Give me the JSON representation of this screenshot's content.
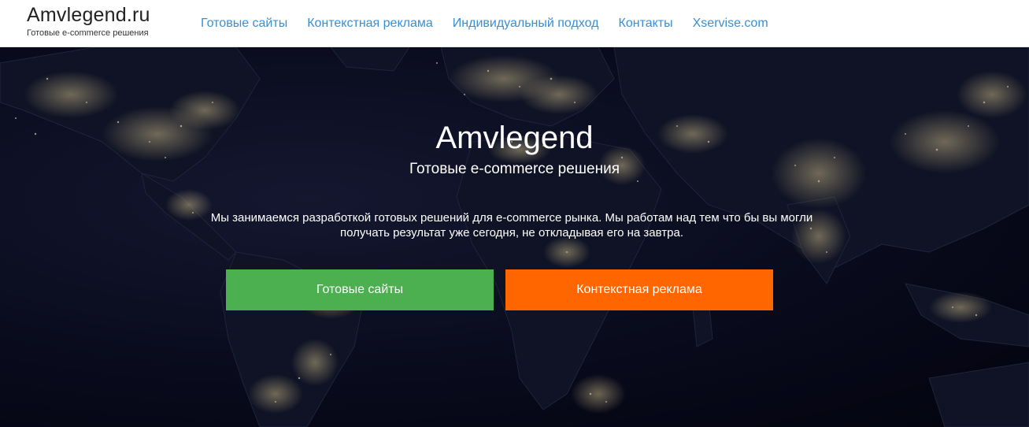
{
  "brand": {
    "name": "Amvlegend.ru",
    "tagline": "Готовые e-commerce решения"
  },
  "nav": {
    "items": [
      {
        "label": "Готовые сайты"
      },
      {
        "label": "Контекстная реклама"
      },
      {
        "label": "Индивидуальный подход"
      },
      {
        "label": "Контакты"
      },
      {
        "label": "Xservise.com"
      }
    ]
  },
  "hero": {
    "title": "Amvlegend",
    "subtitle": "Готовые e-commerce решения",
    "description": "Мы занимаемся разработкой готовых решений для e-commerce рынка. Мы работам над тем что бы вы могли получать результат уже сегодня, не откладывая его на завтра.",
    "primary_button": "Готовые сайты",
    "secondary_button": "Контекстная реклама"
  },
  "colors": {
    "nav_link": "#3a8fd4",
    "primary_button": "#4caf50",
    "secondary_button": "#ff6600",
    "hero_background": "#0b0d1e"
  }
}
